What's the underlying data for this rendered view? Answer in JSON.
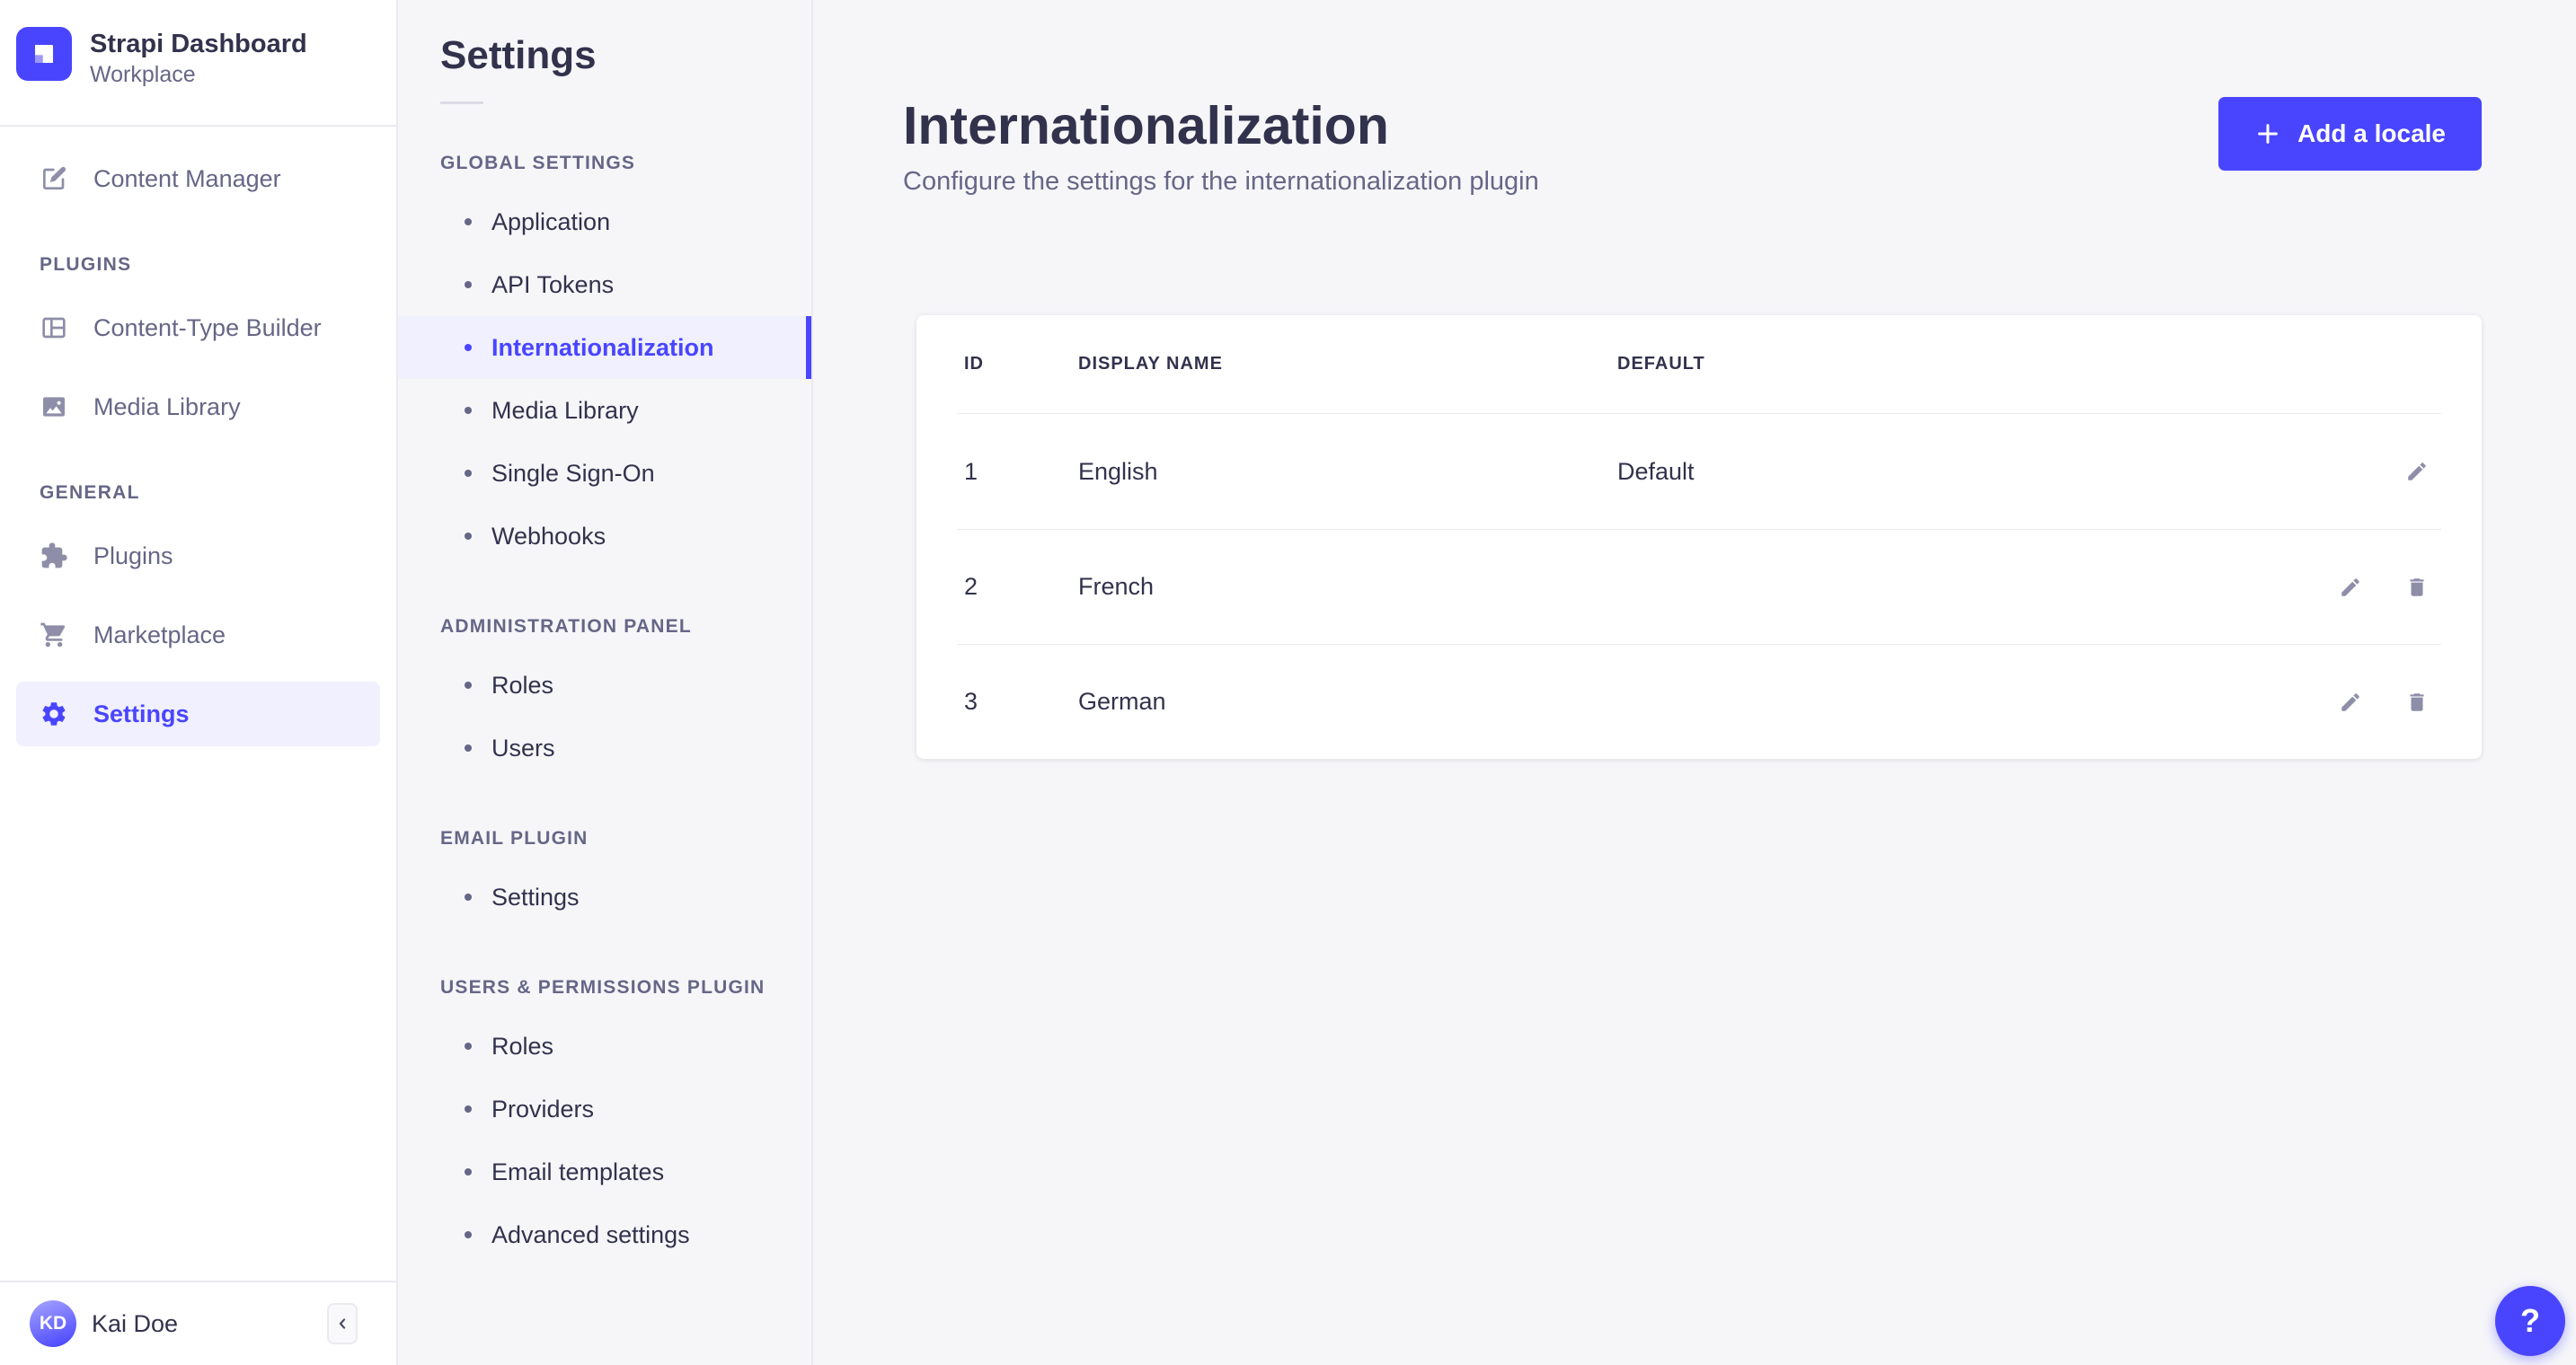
{
  "brand": {
    "name": "Strapi Dashboard",
    "workspace": "Workplace"
  },
  "sidebar": {
    "top_items": [
      {
        "label": "Content Manager"
      }
    ],
    "sections": [
      {
        "header": "PLUGINS",
        "items": [
          {
            "label": "Content-Type Builder"
          },
          {
            "label": "Media Library"
          }
        ]
      },
      {
        "header": "GENERAL",
        "items": [
          {
            "label": "Plugins"
          },
          {
            "label": "Marketplace"
          },
          {
            "label": "Settings",
            "active": true
          }
        ]
      }
    ],
    "user": {
      "name": "Kai Doe",
      "initials": "KD"
    }
  },
  "subnav": {
    "title": "Settings",
    "sections": [
      {
        "header": "GLOBAL SETTINGS",
        "items": [
          {
            "label": "Application"
          },
          {
            "label": "API Tokens"
          },
          {
            "label": "Internationalization",
            "active": true
          },
          {
            "label": "Media Library"
          },
          {
            "label": "Single Sign-On"
          },
          {
            "label": "Webhooks"
          }
        ]
      },
      {
        "header": "ADMINISTRATION PANEL",
        "items": [
          {
            "label": "Roles"
          },
          {
            "label": "Users"
          }
        ]
      },
      {
        "header": "EMAIL PLUGIN",
        "items": [
          {
            "label": "Settings"
          }
        ]
      },
      {
        "header": "USERS & PERMISSIONS PLUGIN",
        "items": [
          {
            "label": "Roles"
          },
          {
            "label": "Providers"
          },
          {
            "label": "Email templates"
          },
          {
            "label": "Advanced settings"
          }
        ]
      }
    ]
  },
  "page": {
    "title": "Internationalization",
    "subtitle": "Configure the settings for the internationalization plugin",
    "add_button": "Add a locale"
  },
  "table": {
    "headers": {
      "id": "ID",
      "display_name": "DISPLAY NAME",
      "default": "DEFAULT"
    },
    "rows": [
      {
        "id": "1",
        "display_name": "English",
        "default": "Default"
      },
      {
        "id": "2",
        "display_name": "French",
        "default": ""
      },
      {
        "id": "3",
        "display_name": "German",
        "default": ""
      }
    ]
  },
  "help": {
    "label": "?"
  },
  "colors": {
    "primary": "#4945ff",
    "primary_light": "#f0f0ff",
    "text_dark": "#32324d",
    "text_muted": "#666687",
    "icon_gray": "#8e8ea9",
    "border": "#eaeaef",
    "panel_bg": "#f6f6f9"
  }
}
